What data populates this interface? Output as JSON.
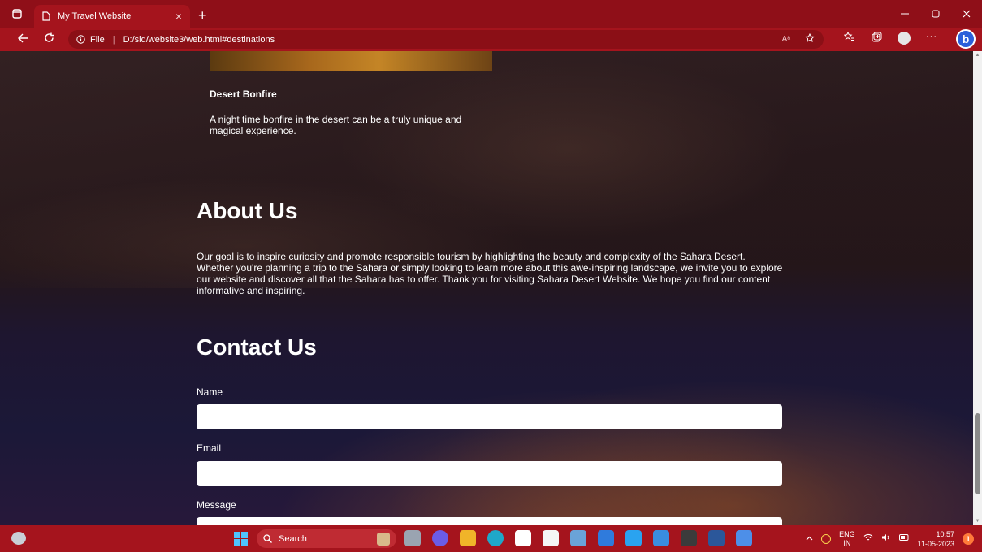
{
  "browser": {
    "tab_title": "My Travel Website",
    "address_scheme": "File",
    "address_url": "D:/sid/website3/web.html#destinations",
    "new_tab_symbol": "+",
    "close_tab_symbol": "×",
    "read_aloud_symbol": "Aᵃ",
    "more_symbol": "···",
    "bing_label": "b"
  },
  "page": {
    "card": {
      "title": "Desert Bonfire",
      "description": "A night time bonfire in the desert can be a truly unique and magical experience."
    },
    "about": {
      "heading": "About Us",
      "text": "Our goal is to inspire curiosity and promote responsible tourism by highlighting the beauty and complexity of the Sahara Desert. Whether you're planning a trip to the Sahara or simply looking to learn more about this awe-inspiring landscape, we invite you to explore our website and discover all that the Sahara has to offer. Thank you for visiting Sahara Desert Website. We hope you find our content informative and inspiring."
    },
    "contact": {
      "heading": "Contact Us",
      "name_label": "Name",
      "email_label": "Email",
      "message_label": "Message",
      "name_value": "",
      "email_value": "",
      "message_value": ""
    }
  },
  "taskbar": {
    "search_label": "Search",
    "language_line1": "ENG",
    "language_line2": "IN",
    "time": "10:57",
    "date": "11-05-2023",
    "notification_count": "1"
  },
  "colors": {
    "chrome": "#a5141d",
    "titlebar": "#8f0f18",
    "bing": "#2b5fd9"
  }
}
